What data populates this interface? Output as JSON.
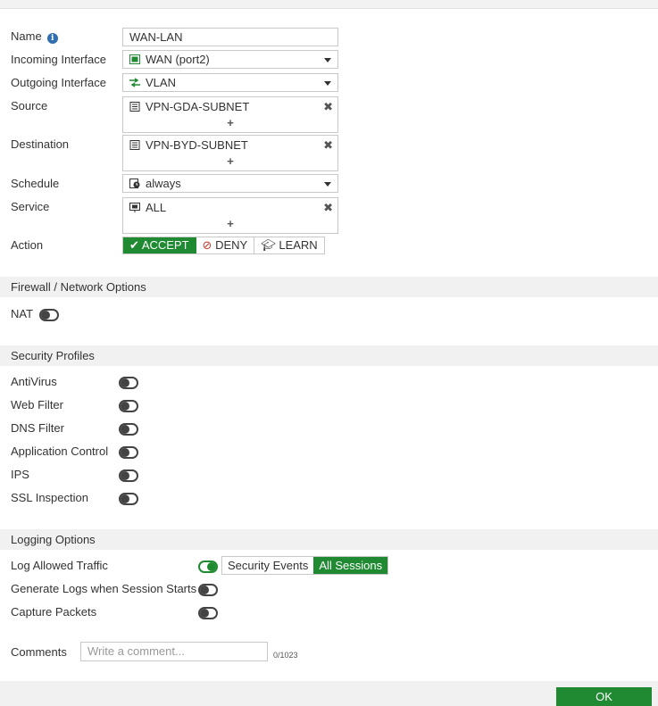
{
  "form": {
    "name_label": "Name",
    "name_value": "WAN-LAN",
    "incoming_label": "Incoming Interface",
    "incoming_value": "WAN (port2)",
    "outgoing_label": "Outgoing Interface",
    "outgoing_value": "VLAN",
    "source_label": "Source",
    "source_value": "VPN-GDA-SUBNET",
    "destination_label": "Destination",
    "destination_value": "VPN-BYD-SUBNET",
    "schedule_label": "Schedule",
    "schedule_value": "always",
    "service_label": "Service",
    "service_value": "ALL",
    "action_label": "Action",
    "actions": [
      "ACCEPT",
      "DENY",
      "LEARN"
    ],
    "selected_action": "ACCEPT",
    "add_symbol": "+",
    "remove_symbol": "✖"
  },
  "firewall_section": {
    "title": "Firewall / Network Options",
    "nat_label": "NAT",
    "nat_enabled": false
  },
  "security_section": {
    "title": "Security Profiles",
    "items": [
      {
        "label": "AntiVirus",
        "enabled": false
      },
      {
        "label": "Web Filter",
        "enabled": false
      },
      {
        "label": "DNS Filter",
        "enabled": false
      },
      {
        "label": "Application Control",
        "enabled": false
      },
      {
        "label": "IPS",
        "enabled": false
      },
      {
        "label": "SSL Inspection",
        "enabled": false
      }
    ]
  },
  "logging_section": {
    "title": "Logging Options",
    "log_allowed_label": "Log Allowed Traffic",
    "log_allowed_enabled": true,
    "log_modes": [
      "Security Events",
      "All Sessions"
    ],
    "selected_log_mode": "All Sessions",
    "generate_logs_label": "Generate Logs when Session Starts",
    "generate_logs_enabled": false,
    "capture_packets_label": "Capture Packets",
    "capture_packets_enabled": false
  },
  "comments": {
    "label": "Comments",
    "placeholder": "Write a comment...",
    "counter": "0/1023"
  },
  "footer": {
    "ok_label": "OK"
  },
  "colors": {
    "accent_green": "#1f8a32",
    "info_blue": "#2f6fb2",
    "section_bg": "#f1f1f1"
  }
}
